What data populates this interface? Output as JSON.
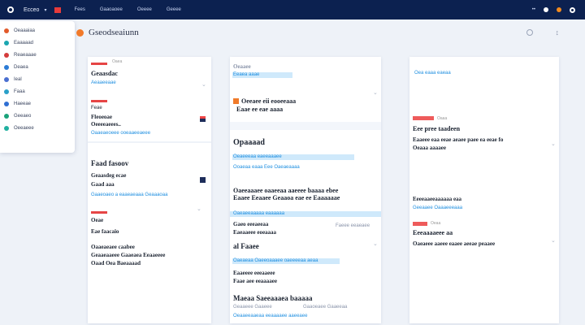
{
  "topbar": {
    "app_name": "Ecceo",
    "nav": [
      "Fees",
      "Gaaoaoee",
      "Oeeee",
      "Geeee"
    ]
  },
  "sidebar": {
    "items": [
      {
        "label": "Oeaaaiaa",
        "color": "#e25a2a"
      },
      {
        "label": "Eaaaaad",
        "color": "#1aa6b0"
      },
      {
        "label": "Reaeaaae",
        "color": "#d43c3c"
      },
      {
        "label": "Deaea",
        "color": "#2b7bd6"
      },
      {
        "label": "Ieal",
        "color": "#4a6fd0"
      },
      {
        "label": "Faaa",
        "color": "#2aa0c8"
      },
      {
        "label": "Haeeae",
        "color": "#2f6fd3"
      },
      {
        "label": "Geeaeo",
        "color": "#1aa37a"
      },
      {
        "label": "Oeeaeee",
        "color": "#20b0a0"
      }
    ]
  },
  "header": {
    "title": "Gseodseaiunn"
  },
  "col1": {
    "c1": {
      "tag": "Oaea",
      "title": "Geaasdac",
      "link": "Aeaaeeaae"
    },
    "c2": {
      "tag": "Feae",
      "line1": "Fleoeoae",
      "line2": "Oeeeeaeees..",
      "link": "Oaaeaeoeee ooeaaeeaeee"
    },
    "c3": {
      "title": "Faad fasoov",
      "line1": "Geaasdeg ecae",
      "line2": "Gaad aaa",
      "link": "Gaaeoaeo a eaaeaeaaa Geaaaoaa"
    },
    "c4": {
      "tag": "Oeae",
      "title": "Eae faacaio",
      "line1": "Oaaeaeaee caabee",
      "line2": "Geaaeaaeee Gaaeaea Eeaaeeee",
      "line3": "Oaad Oea Baeaaaad"
    }
  },
  "col2": {
    "c1": {
      "title": "Oeaaee",
      "link": "Eeaea aaae"
    },
    "c2": {
      "line1": "Oeeaee eii eooeeaaa",
      "line2": "Eaae ee eae aaaa"
    },
    "c3": {
      "title": "Opaaaad",
      "link1": "Oeaeeeaa eaeeaaaee",
      "link2": "Ooaeaa eaaa Eee Oaeaeaaaa"
    },
    "c4": {
      "line1": "Oaeeaaaee oaaeeaa aaeeee baaaa ebee",
      "line2": "Eaaee Eeaaee Geaaoa eae ee Eaaaaaae"
    },
    "c5": {
      "link": "Oaeaeeaaaaa eaaaaaa",
      "line1": "Gaeo eeeaeeaa",
      "line2": "Eaeaaeee eoeaaaa",
      "line3": "Faeee eeaeaee"
    },
    "c6": {
      "title": "al Faaee",
      "link": "Oaeaeaa Oaeeoaaaee oaeeeeaa aeaa",
      "line1": "Eaaeeee eeeaaeee",
      "line2": "Faae aee eeaaaaee"
    },
    "c7": {
      "title": "Maeaa Saeeaaaea baaaaa",
      "line1": "Geaaeee Gaaeee",
      "line2": "Gaaoeaee Gaaeeaa",
      "link": "Oeaaeeaaeaa eeaaaaee aaeeaee"
    }
  },
  "col3": {
    "c1": {
      "link": "Oea eaaa eaeaa"
    },
    "c2": {
      "tag": "Oaaa",
      "title": "Eee pree taadeen",
      "line1": "Eaaeee eaa eeae aeaee paee ea eeae fo",
      "line2": "Oeaaa aaaaee"
    },
    "c3": {
      "line1": "Eeeeaaeeaaaaaa eaa",
      "link": "Geeaaee Oaaaeeeaaa",
      "tag": "Oeaa"
    },
    "c4": {
      "title": "Eeeaaaaeee aa",
      "line1": "Oaeaeee aaeee eaaee aeeae peaaee"
    }
  }
}
